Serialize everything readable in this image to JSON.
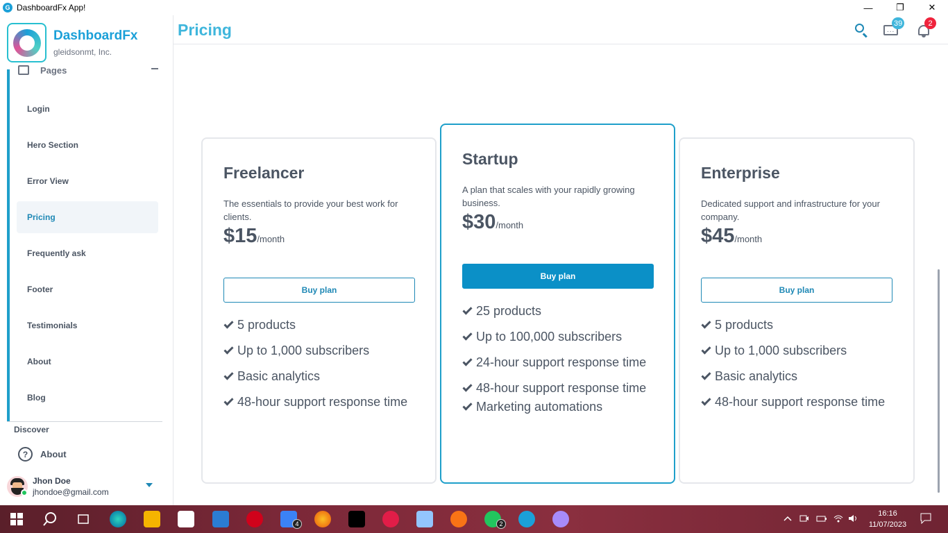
{
  "window": {
    "title": "DashboardFx App!",
    "minimize": "—",
    "restore": "❐",
    "close": "✕"
  },
  "brand": {
    "name": "DashboardFx",
    "company": "gleidsonmt, Inc."
  },
  "sidebar": {
    "section_label": "Pages",
    "items": [
      {
        "label": "Login",
        "active": false
      },
      {
        "label": "Hero Section",
        "active": false
      },
      {
        "label": "Error View",
        "active": false
      },
      {
        "label": "Pricing",
        "active": true
      },
      {
        "label": "Frequently ask",
        "active": false
      },
      {
        "label": "Footer",
        "active": false
      },
      {
        "label": "Testimonials",
        "active": false
      },
      {
        "label": "About",
        "active": false
      },
      {
        "label": "Blog",
        "active": false
      }
    ],
    "discover_label": "Discover",
    "about_label": "About",
    "about_icon": "?",
    "user": {
      "name": "Jhon Doe",
      "email": "jhondoe@gmail.com"
    }
  },
  "header": {
    "title": "Pricing",
    "messages_count": "39",
    "notifications_count": "2"
  },
  "plans": [
    {
      "name": "Freelancer",
      "description": "The essentials to provide your best work for clients.",
      "price": "$15",
      "period": "/month",
      "button": "Buy plan",
      "features": [
        "5 products",
        "Up to 1,000 subscribers",
        "Basic analytics",
        "48-hour support response time"
      ]
    },
    {
      "name": "Startup",
      "description": "A plan that scales with your rapidly growing business.",
      "price": "$30",
      "period": "/month",
      "button": "Buy plan",
      "featured": true,
      "features": [
        "25 products",
        "Up to 100,000 subscribers",
        "24-hour support response time",
        "48-hour support response time",
        "Marketing automations"
      ]
    },
    {
      "name": "Enterprise",
      "description": "Dedicated support and infrastructure for your company.",
      "price": "$45",
      "period": "/month",
      "button": "Buy plan",
      "features": [
        "5 products",
        "Up to 1,000 subscribers",
        "Basic analytics",
        "48-hour support response time"
      ]
    }
  ],
  "taskbar": {
    "time": "16:16",
    "date": "11/07/2023",
    "badges": [
      "4",
      "2"
    ]
  },
  "colors": {
    "accent": "#1e88b5",
    "title": "#3fb6dc",
    "badge_blue": "#3fb6dc",
    "badge_red": "#ef233c"
  }
}
